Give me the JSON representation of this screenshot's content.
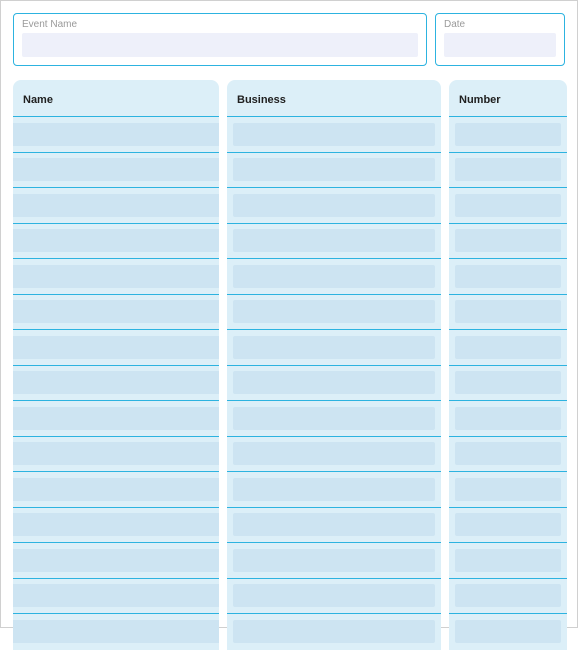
{
  "header": {
    "event_label": "Event Name",
    "event_value": "",
    "date_label": "Date",
    "date_value": ""
  },
  "columns": {
    "name": {
      "label": "Name"
    },
    "business": {
      "label": "Business"
    },
    "number": {
      "label": "Number"
    }
  },
  "rows": [
    {
      "name": "",
      "business": "",
      "number": ""
    },
    {
      "name": "",
      "business": "",
      "number": ""
    },
    {
      "name": "",
      "business": "",
      "number": ""
    },
    {
      "name": "",
      "business": "",
      "number": ""
    },
    {
      "name": "",
      "business": "",
      "number": ""
    },
    {
      "name": "",
      "business": "",
      "number": ""
    },
    {
      "name": "",
      "business": "",
      "number": ""
    },
    {
      "name": "",
      "business": "",
      "number": ""
    },
    {
      "name": "",
      "business": "",
      "number": ""
    },
    {
      "name": "",
      "business": "",
      "number": ""
    },
    {
      "name": "",
      "business": "",
      "number": ""
    },
    {
      "name": "",
      "business": "",
      "number": ""
    },
    {
      "name": "",
      "business": "",
      "number": ""
    },
    {
      "name": "",
      "business": "",
      "number": ""
    },
    {
      "name": "",
      "business": "",
      "number": ""
    }
  ]
}
